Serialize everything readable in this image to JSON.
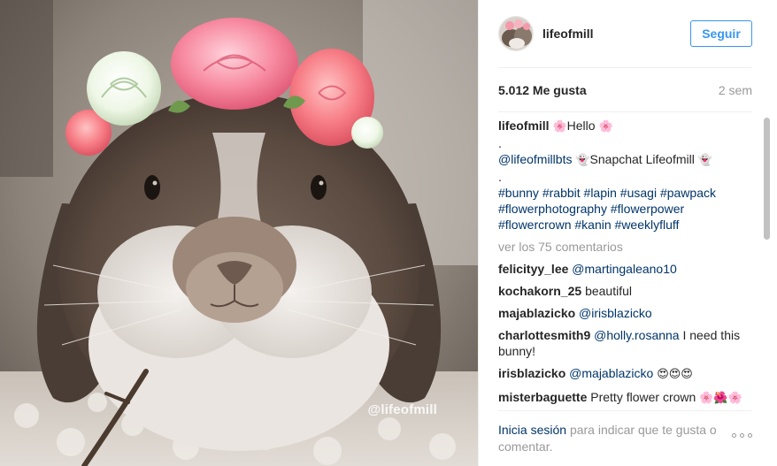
{
  "photo": {
    "watermark": "@lifeofmill",
    "alt": "rabbit-with-flower-crown"
  },
  "header": {
    "username": "lifeofmill",
    "follow_label": "Seguir"
  },
  "stats": {
    "likes": "5.012 Me gusta",
    "time": "2 sem"
  },
  "caption": {
    "username": "lifeofmill",
    "text": "Hello",
    "dot1": ".",
    "bts_handle": "@lifeofmillbts",
    "snapchat_text": "Snapchat Lifeofmill",
    "dot2": ".",
    "hashtags": [
      "#bunny",
      "#rabbit",
      "#lapin",
      "#usagi",
      "#pawpack",
      "#flowerphotography",
      "#flowerpower",
      "#flowercrown",
      "#kanin",
      "#weeklyfluff"
    ]
  },
  "view_all_label": "ver los 75 comentarios",
  "comments": [
    {
      "user": "felicityy_lee",
      "mention": "@martingaleano10",
      "text": ""
    },
    {
      "user": "kochakorn_25",
      "mention": "",
      "text": "beautiful"
    },
    {
      "user": "majablazicko",
      "mention": "@irisblazicko",
      "text": ""
    },
    {
      "user": "charlottesmith9",
      "mention": "@holly.rosanna",
      "text": "I need this bunny!"
    },
    {
      "user": "irisblazicko",
      "mention": "@majablazicko",
      "text": "",
      "emoji": "😍😍😍"
    },
    {
      "user": "misterbaguette",
      "mention": "",
      "text": "Pretty flower crown",
      "emoji": "🌸🌺🌸"
    }
  ],
  "footer": {
    "login_label": "Inicia sesión",
    "prompt": "para indicar que te gusta o comentar."
  },
  "icons": {
    "blossom": "🌸",
    "ghost": "👻",
    "more": "more-options-icon"
  },
  "colors": {
    "link": "#003569",
    "accent": "#3897f0",
    "muted": "#999999",
    "text": "#262626"
  }
}
